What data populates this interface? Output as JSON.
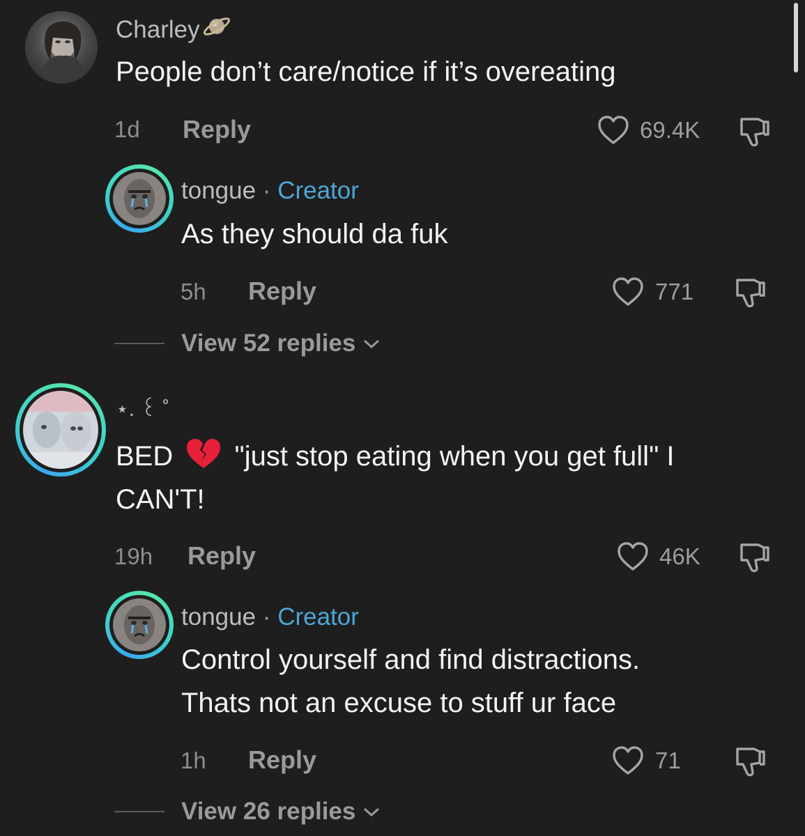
{
  "comments": [
    {
      "username": "Charley",
      "text": "People don’t care/notice if it’s overeating",
      "time": "1d",
      "reply_label": "Reply",
      "likes": "69.4K"
    },
    {
      "username": "tongue",
      "badge_sep": "·",
      "badge": "Creator",
      "text": "As they should da fuk",
      "time": "5h",
      "reply_label": "Reply",
      "likes": "771",
      "view_replies": "View 52 replies"
    },
    {
      "username": "⋆. ꒰ ˚",
      "text_line1_a": "BED",
      "text_line1_emoji": "💔",
      "text_line1_b": "\"just stop eating when you get full\" I",
      "text_line2": "CAN'T!",
      "time": "19h",
      "reply_label": "Reply",
      "likes": "46K"
    },
    {
      "username": "tongue",
      "badge_sep": "·",
      "badge": "Creator",
      "text_line1": "Control yourself and find distractions.",
      "text_line2": "Thats not an excuse to stuff ur face",
      "time": "1h",
      "reply_label": "Reply",
      "likes": "71",
      "view_replies": "View 26 replies"
    }
  ],
  "colors": {
    "background": "#1e1e1e",
    "creator_badge": "#4ea6d6",
    "story_ring": "#3fd4c8"
  },
  "icons": [
    "saturn-icon",
    "heart-outline-icon",
    "thumbs-down-icon",
    "chevron-down-icon"
  ]
}
